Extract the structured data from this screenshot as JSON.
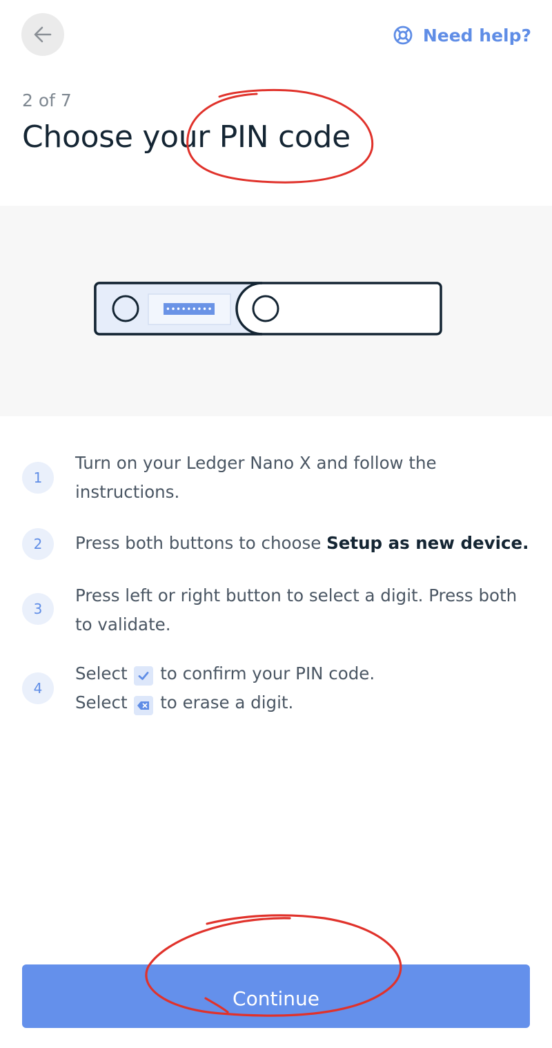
{
  "header": {
    "back_icon": "arrow-left-icon",
    "help_icon": "lifebuoy-icon",
    "help_label": "Need help?"
  },
  "progress": {
    "step_label": "2 of 7"
  },
  "title": "Choose your PIN code",
  "illustration": {
    "screen_text": "•••••••••"
  },
  "steps": [
    {
      "number": "1",
      "text": "Turn on your Ledger Nano X and follow the instructions."
    },
    {
      "number": "2",
      "text_before": "Press both buttons to choose ",
      "text_bold": "Setup as new device."
    },
    {
      "number": "3",
      "text": "Press left or right button to select a digit. Press both to validate."
    },
    {
      "number": "4",
      "line1_before": "Select",
      "line1_icon": "checkmark-icon",
      "line1_after": "to confirm your PIN code.",
      "line2_before": "Select",
      "line2_icon": "backspace-icon",
      "line2_after": "to erase a digit."
    }
  ],
  "footer": {
    "continue_label": "Continue"
  },
  "colors": {
    "accent": "#6490eb",
    "title": "#142533",
    "body_text": "#4a5663",
    "annotation": "#e0322b"
  }
}
